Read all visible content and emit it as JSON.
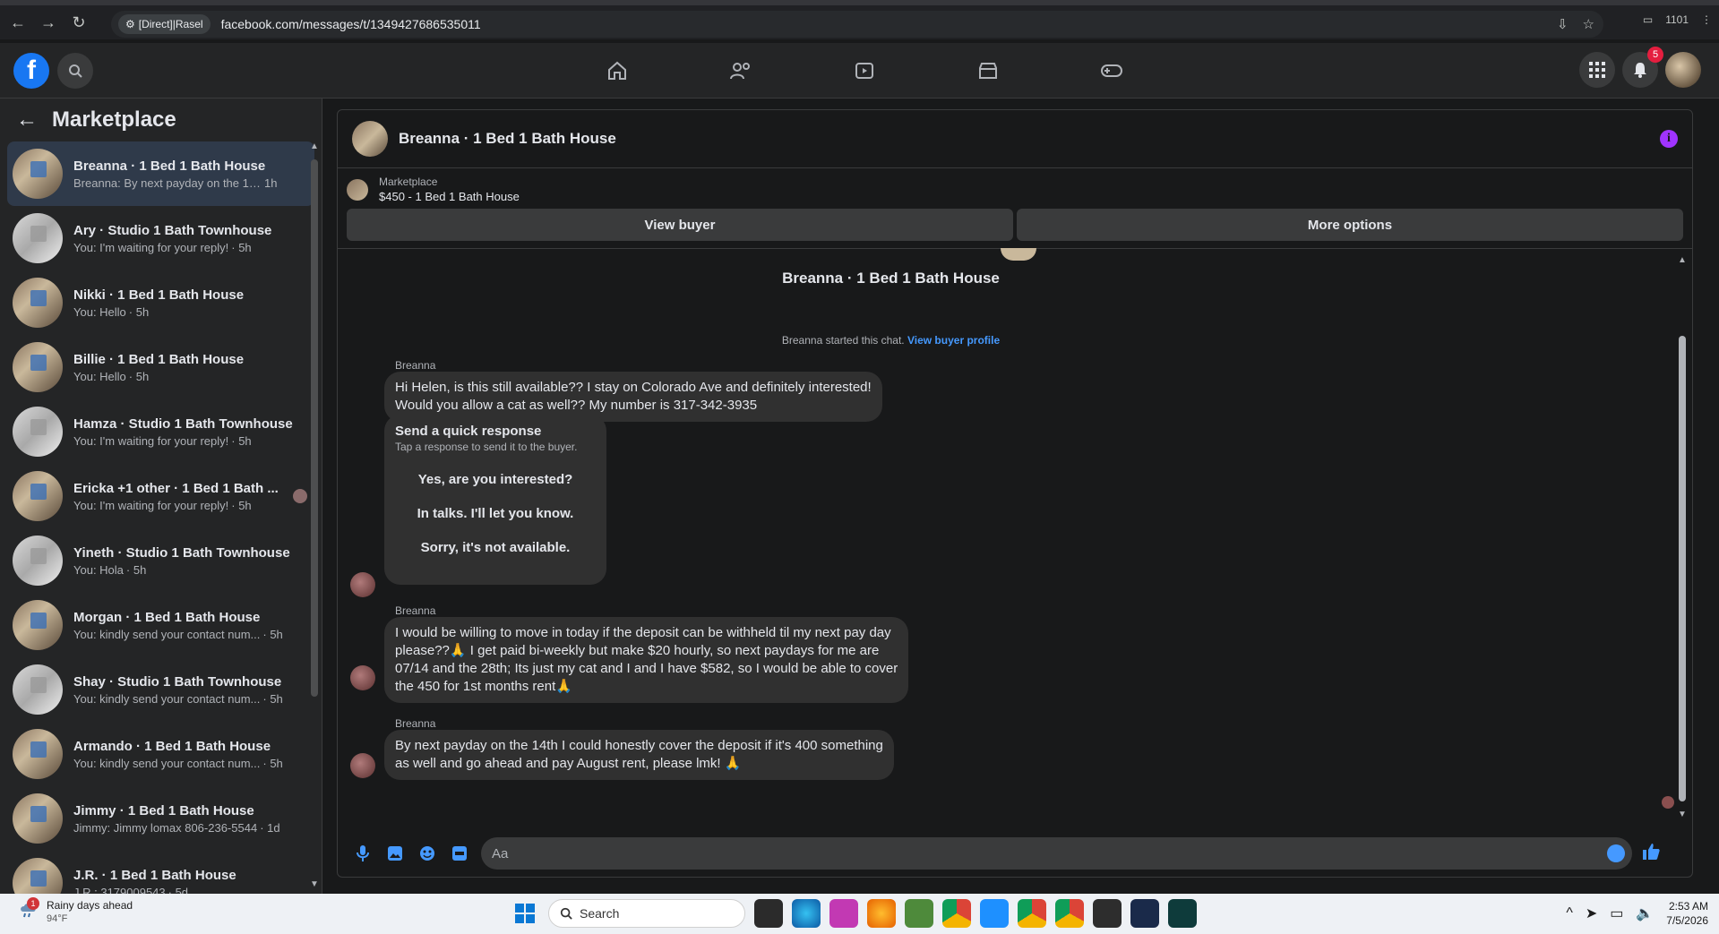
{
  "browser": {
    "profile_chip": "[Direct]|Rasel",
    "url": "facebook.com/messages/t/1349427686535011",
    "right_counter": "1101"
  },
  "topbar": {
    "logo": "f",
    "notifications_count": "5"
  },
  "sidebar": {
    "title": "Marketplace",
    "conversations": [
      {
        "title": "Breanna · 1 Bed 1 Bath House",
        "snippet": "Breanna: By next payday on the 14t...",
        "time": "1h",
        "thumb": "house",
        "active": true
      },
      {
        "title": "Ary · Studio 1 Bath Townhouse",
        "snippet": "You: I'm waiting for your reply!",
        "time": "· 5h",
        "thumb": "white"
      },
      {
        "title": "Nikki · 1 Bed 1 Bath House",
        "snippet": "You: Hello",
        "time": "· 5h",
        "thumb": "house"
      },
      {
        "title": "Billie · 1 Bed 1 Bath House",
        "snippet": "You: Hello",
        "time": "· 5h",
        "thumb": "house"
      },
      {
        "title": "Hamza · Studio 1 Bath Townhouse",
        "snippet": "You: I'm waiting for your reply!",
        "time": "· 5h",
        "thumb": "white"
      },
      {
        "title": "Ericka +1 other · 1 Bed 1 Bath ...",
        "snippet": "You: I'm waiting for your reply!",
        "time": "· 5h",
        "thumb": "house"
      },
      {
        "title": "Yineth · Studio 1 Bath Townhouse",
        "snippet": "You: Hola",
        "time": "· 5h",
        "thumb": "white"
      },
      {
        "title": "Morgan · 1 Bed 1 Bath House",
        "snippet": "You: kindly send your contact num...",
        "time": "· 5h",
        "thumb": "house"
      },
      {
        "title": "Shay · Studio 1 Bath Townhouse",
        "snippet": "You: kindly send your contact num...",
        "time": "· 5h",
        "thumb": "white"
      },
      {
        "title": "Armando · 1 Bed 1 Bath House",
        "snippet": "You: kindly send your contact num...",
        "time": "· 5h",
        "thumb": "house"
      },
      {
        "title": "Jimmy · 1 Bed 1 Bath House",
        "snippet": "Jimmy: Jimmy lomax 806-236-5544",
        "time": "· 1d",
        "thumb": "house"
      },
      {
        "title": "J.R. · 1 Bed 1 Bath House",
        "snippet": "J.R.: 3179009543",
        "time": "· 5d",
        "thumb": "house"
      }
    ]
  },
  "chat": {
    "header_title": "Breanna · 1 Bed 1 Bath House",
    "marketplace_label": "Marketplace",
    "listing": "$450 - 1 Bed 1 Bath House",
    "view_buyer": "View buyer",
    "more_options": "More options",
    "center_name": "Breanna · 1 Bed 1 Bath House",
    "started_text": "Breanna started this chat.",
    "view_buyer_profile": "View buyer profile",
    "sender": "Breanna",
    "msg1_line1": "Hi Helen, is this still available?? I stay on Colorado Ave and definitely interested!",
    "msg1_line2": "Would you allow a cat as well?? My number is 317-342-3935",
    "quick": {
      "title": "Send a quick response",
      "subtitle": "Tap a response to send it to the buyer.",
      "opt1": "Yes, are you interested?",
      "opt2": "In talks. I'll let you know.",
      "opt3": "Sorry, it's not available."
    },
    "msg2_line1": "I would be willing to move in today if the deposit can be withheld til my next pay day",
    "msg2_line2": "please??🙏 I get paid bi-weekly but make $20 hourly, so next paydays for me are",
    "msg2_line3": "07/14 and the 28th; Its just my cat and I and I have $582, so I would be able to cover",
    "msg2_line4": "the 450 for 1st months rent🙏",
    "msg3_line1": "By next payday on the 14th I could honestly cover the deposit if it's 400 something",
    "msg3_line2": "as well and go ahead and pay August rent, please lmk! 🙏",
    "composer_placeholder": "Aa"
  },
  "taskbar": {
    "weather_title": "Rainy days ahead",
    "weather_temp": "94°F",
    "weather_badge": "1",
    "search_label": "Search",
    "time": "2:53 AM",
    "date": "7/5/2026"
  },
  "colors": {
    "accent": "#4599ff",
    "info": "#a033ff",
    "fb_blue": "#1877f2"
  }
}
